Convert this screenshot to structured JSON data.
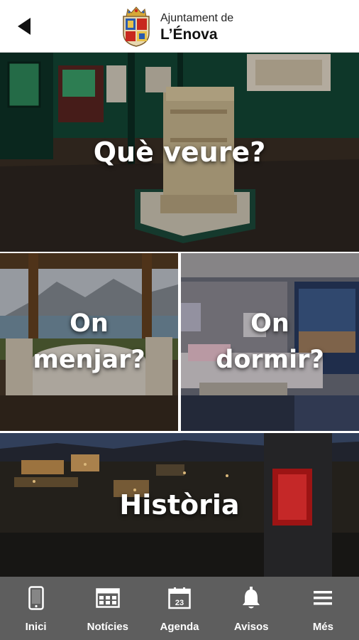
{
  "header": {
    "brand_line1": "Ajuntament de",
    "brand_line2": "L’Énova",
    "icons": [
      "back-arrow-icon",
      "crest-logo"
    ]
  },
  "tiles": [
    {
      "label": "Què veure?",
      "image": "museum-altar"
    },
    {
      "label_line1": "On",
      "label_line2": "menjar?",
      "image": "restaurant-terrace"
    },
    {
      "label_line1": "On",
      "label_line2": "dormir?",
      "image": "hotel-room"
    },
    {
      "label": "Història",
      "image": "village-at-night"
    }
  ],
  "nav": {
    "items": [
      {
        "label": "Inici",
        "icon": "phone-icon"
      },
      {
        "label": "Notícies",
        "icon": "newspaper-icon"
      },
      {
        "label": "Agenda",
        "icon": "calendar-icon",
        "icon_text": "23"
      },
      {
        "label": "Avisos",
        "icon": "bell-icon"
      },
      {
        "label": "Més",
        "icon": "menu-icon"
      }
    ]
  },
  "colors": {
    "nav_background": "#5e5e5e",
    "header_background": "#ffffff",
    "label_color": "#ffffff"
  }
}
